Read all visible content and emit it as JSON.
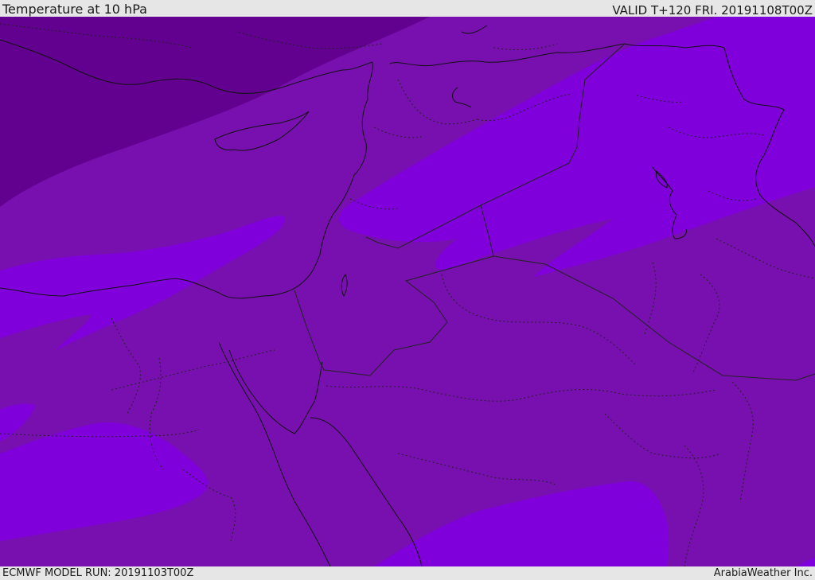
{
  "header": {
    "title": "Temperature at 10 hPa",
    "valid": "VALID T+120 FRI. 20191108T00Z"
  },
  "footer": {
    "model_run": "ECMWF MODEL RUN: 20191103T00Z",
    "credit": "ArabiaWeather Inc."
  },
  "map": {
    "colors": {
      "coldest": "#62008f",
      "mid": "#7810b0",
      "warm": "#8000dc",
      "coast": "#111111",
      "border": "#222222"
    }
  }
}
